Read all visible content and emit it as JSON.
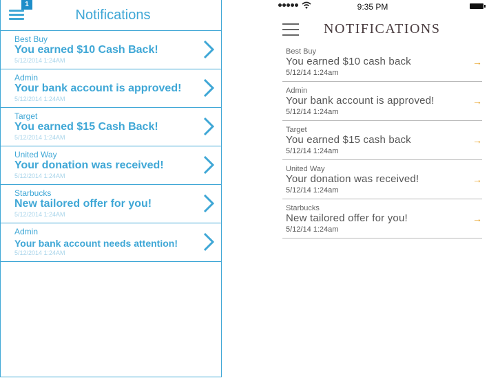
{
  "left": {
    "badge": "1",
    "title": "Notifications",
    "items": [
      {
        "source": "Best Buy",
        "message": "You earned $10 Cash Back!",
        "time": "5/12/2014  1:24AM"
      },
      {
        "source": "Admin",
        "message": "Your bank account is approved!",
        "time": "5/12/2014  1:24AM"
      },
      {
        "source": "Target",
        "message": "You earned $15 Cash Back!",
        "time": "5/12/2014  1:24AM"
      },
      {
        "source": "United Way",
        "message": "Your donation was received!",
        "time": "5/12/2014  1:24AM"
      },
      {
        "source": "Starbucks",
        "message": "New tailored offer for you!",
        "time": "5/12/2014  1:24AM"
      },
      {
        "source": "Admin",
        "message": "Your bank account needs attention!",
        "time": "5/12/2014  1:24AM"
      }
    ],
    "accent_color": "#3fa7d6"
  },
  "right": {
    "status_time": "9:35 PM",
    "title": "NOTIFICATIONS",
    "items": [
      {
        "source": "Best Buy",
        "message": "You earned $10 cash back",
        "time": "5/12/14 1:24am"
      },
      {
        "source": "Admin",
        "message": "Your bank account is approved!",
        "time": "5/12/14 1:24am"
      },
      {
        "source": "Target",
        "message": "You earned $15 cash back",
        "time": "5/12/14 1:24am"
      },
      {
        "source": "United Way",
        "message": "Your donation was received!",
        "time": "5/12/14 1:24am"
      },
      {
        "source": "Starbucks",
        "message": "New tailored offer for you!",
        "time": "5/12/14 1:24am"
      }
    ],
    "arrow": "→",
    "arrow_color": "#e8a020"
  }
}
